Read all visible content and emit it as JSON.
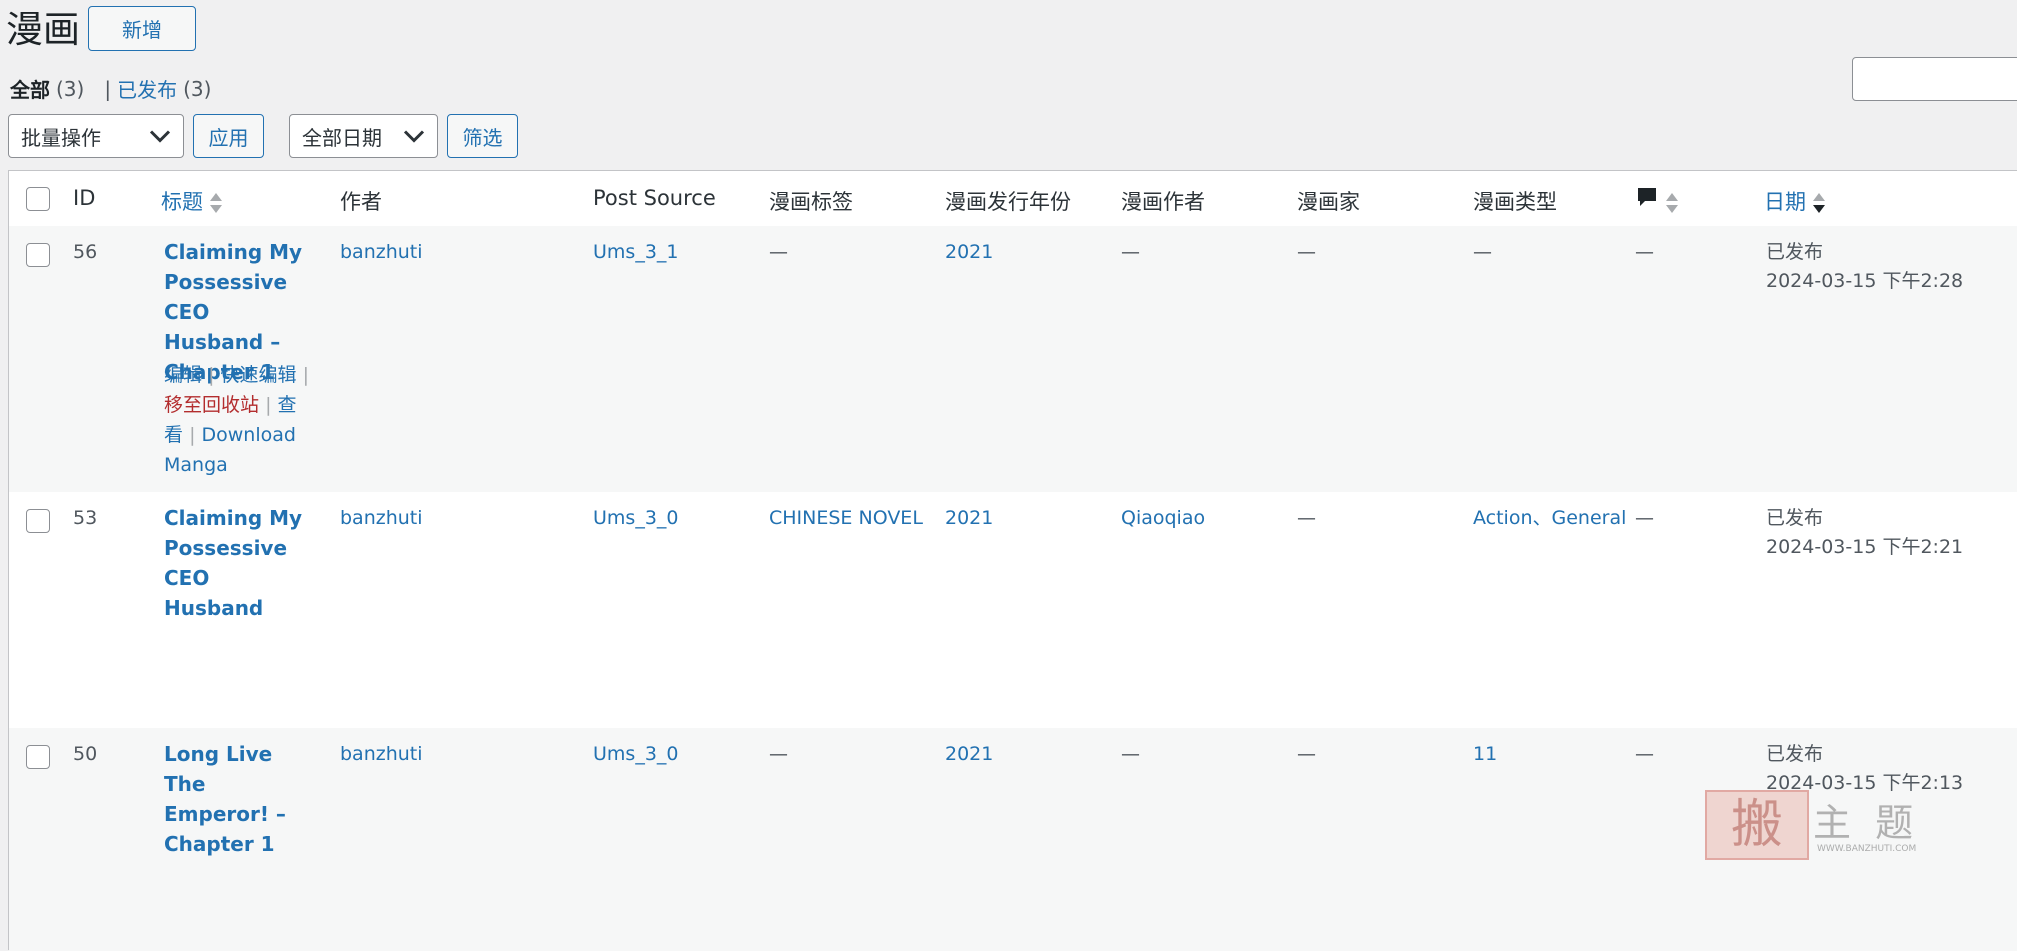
{
  "header": {
    "title": "漫画",
    "add_new": "新增"
  },
  "views": {
    "all_label": "全部",
    "all_count": "(3)",
    "separator": "|",
    "published_label": "已发布",
    "published_count": "(3)"
  },
  "toolbar": {
    "bulk_action": "批量操作",
    "apply": "应用",
    "date_filter": "全部日期",
    "filter": "筛选"
  },
  "columns": {
    "id": "ID",
    "title": "标题",
    "author": "作者",
    "post_source": "Post Source",
    "tags": "漫画标签",
    "year": "漫画发行年份",
    "manga_author": "漫画作者",
    "artist": "漫画家",
    "genre": "漫画类型",
    "date": "日期"
  },
  "rows": [
    {
      "id": "56",
      "title_lines": [
        "Claiming My",
        "Possessive CEO",
        "Husband –",
        "Chapter 1"
      ],
      "author": "banzhuti",
      "post_source": "Ums_3_1",
      "tags": "—",
      "year": "2021",
      "manga_author": "—",
      "artist": "—",
      "genre": "—",
      "comments": "—",
      "status": "已发布",
      "datetime": "2024-03-15 下午2:28",
      "actions": {
        "edit": "编辑",
        "quick_edit": "快速编辑",
        "trash_a": "移至回收站",
        "view_a": "查",
        "view_b": "看",
        "download_a": "Download",
        "download_b": "Manga",
        "sep": "|"
      }
    },
    {
      "id": "53",
      "title_lines": [
        "Claiming My",
        "Possessive CEO",
        "Husband"
      ],
      "author": "banzhuti",
      "post_source": "Ums_3_0",
      "tags": "CHINESE NOVEL",
      "year": "2021",
      "manga_author": "Qiaoqiao",
      "artist": "—",
      "genre": "Action、General",
      "comments": "—",
      "status": "已发布",
      "datetime": "2024-03-15 下午2:21"
    },
    {
      "id": "50",
      "title_lines": [
        "Long Live The",
        "Emperor! –",
        "Chapter 1"
      ],
      "author": "banzhuti",
      "post_source": "Ums_3_0",
      "tags": "—",
      "year": "2021",
      "manga_author": "—",
      "artist": "—",
      "genre": "11",
      "comments": "—",
      "status": "已发布",
      "datetime": "2024-03-15 下午2:13"
    }
  ],
  "watermark": {
    "glyph": "搬",
    "text": "主 题",
    "url": "WWW.BANZHUTI.COM"
  },
  "colors": {
    "link": "#2271b1",
    "trash": "#b32d2e",
    "background": "#f0f0f1"
  }
}
